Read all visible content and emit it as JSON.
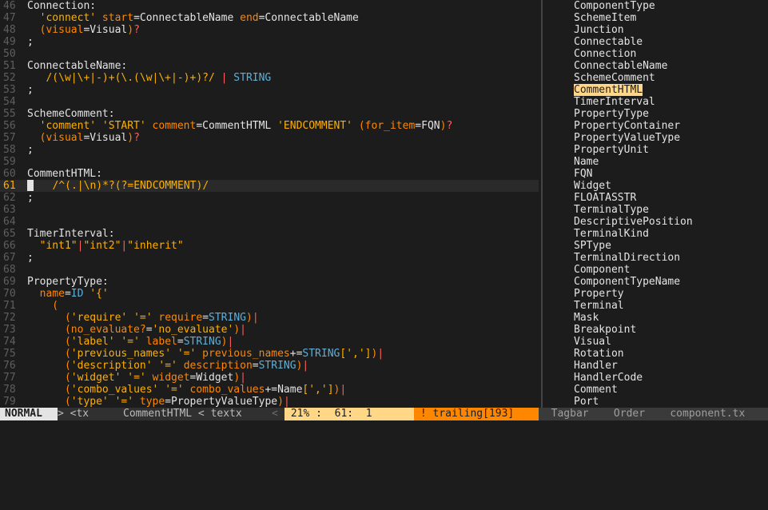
{
  "editor": {
    "lines": [
      {
        "n": "46",
        "segs": [
          [
            "w",
            "Connection:"
          ]
        ]
      },
      {
        "n": "47",
        "segs": [
          [
            "s",
            "  'connect'"
          ],
          [
            "w",
            " "
          ],
          [
            "k",
            "start"
          ],
          [
            "w",
            "=ConnectableName "
          ],
          [
            "k",
            "end"
          ],
          [
            "w",
            "=ConnectableName"
          ]
        ]
      },
      {
        "n": "48",
        "segs": [
          [
            "w",
            "  "
          ],
          [
            "k",
            "(visual"
          ],
          [
            "w",
            "=Visual"
          ],
          [
            "k",
            ")"
          ],
          [
            "op",
            "?"
          ]
        ]
      },
      {
        "n": "49",
        "segs": [
          [
            "w",
            ";"
          ]
        ]
      },
      {
        "n": "50",
        "segs": []
      },
      {
        "n": "51",
        "segs": [
          [
            "w",
            "ConnectableName:"
          ]
        ]
      },
      {
        "n": "52",
        "segs": [
          [
            "s",
            "   /(\\w|\\+|-)+(\\.(\\w|\\+|-)+)?/"
          ],
          [
            "w",
            " "
          ],
          [
            "op",
            "|"
          ],
          [
            "w",
            " "
          ],
          [
            "ty",
            "STRING"
          ]
        ]
      },
      {
        "n": "53",
        "segs": [
          [
            "w",
            ";"
          ]
        ]
      },
      {
        "n": "54",
        "segs": []
      },
      {
        "n": "55",
        "segs": [
          [
            "w",
            "SchemeComment:"
          ]
        ]
      },
      {
        "n": "56",
        "segs": [
          [
            "s",
            "  'comment' 'START'"
          ],
          [
            "w",
            " "
          ],
          [
            "k",
            "comment"
          ],
          [
            "w",
            "=CommentHTML "
          ],
          [
            "s",
            "'ENDCOMMENT'"
          ],
          [
            "w",
            " "
          ],
          [
            "k",
            "(for_item"
          ],
          [
            "w",
            "=FQN"
          ],
          [
            "k",
            ")"
          ],
          [
            "op",
            "?"
          ]
        ]
      },
      {
        "n": "57",
        "segs": [
          [
            "w",
            "  "
          ],
          [
            "k",
            "(visual"
          ],
          [
            "w",
            "=Visual"
          ],
          [
            "k",
            ")"
          ],
          [
            "op",
            "?"
          ]
        ]
      },
      {
        "n": "58",
        "segs": [
          [
            "w",
            ";"
          ]
        ]
      },
      {
        "n": "59",
        "segs": []
      },
      {
        "n": "60",
        "segs": [
          [
            "w",
            "CommentHTML:"
          ]
        ]
      },
      {
        "n": "61",
        "cur": true,
        "segs": [
          [
            "cursor",
            ""
          ],
          [
            "s",
            "   /^(.|\\n)*?(?=ENDCOMMENT)/"
          ]
        ]
      },
      {
        "n": "62",
        "segs": [
          [
            "w",
            ";"
          ]
        ]
      },
      {
        "n": "63",
        "segs": []
      },
      {
        "n": "64",
        "segs": []
      },
      {
        "n": "65",
        "segs": [
          [
            "w",
            "TimerInterval:"
          ]
        ]
      },
      {
        "n": "66",
        "segs": [
          [
            "s",
            "  \"int1\""
          ],
          [
            "op",
            "|"
          ],
          [
            "s",
            "\"int2\""
          ],
          [
            "op",
            "|"
          ],
          [
            "s",
            "\"inherit\""
          ]
        ]
      },
      {
        "n": "67",
        "segs": [
          [
            "w",
            ";"
          ]
        ]
      },
      {
        "n": "68",
        "segs": []
      },
      {
        "n": "69",
        "segs": [
          [
            "w",
            "PropertyType:"
          ]
        ]
      },
      {
        "n": "70",
        "segs": [
          [
            "w",
            "  "
          ],
          [
            "k",
            "name"
          ],
          [
            "w",
            "="
          ],
          [
            "ty",
            "ID"
          ],
          [
            "w",
            " "
          ],
          [
            "s",
            "'{'"
          ]
        ]
      },
      {
        "n": "71",
        "segs": [
          [
            "k",
            "    ("
          ]
        ]
      },
      {
        "n": "72",
        "segs": [
          [
            "w",
            "      "
          ],
          [
            "k",
            "("
          ],
          [
            "s",
            "'require'"
          ],
          [
            "w",
            " "
          ],
          [
            "s",
            "'='"
          ],
          [
            "w",
            " "
          ],
          [
            "k",
            "require"
          ],
          [
            "w",
            "="
          ],
          [
            "ty",
            "STRING"
          ],
          [
            "k",
            ")"
          ],
          [
            "op",
            "|"
          ]
        ]
      },
      {
        "n": "73",
        "segs": [
          [
            "w",
            "      "
          ],
          [
            "k",
            "(no_evaluate?"
          ],
          [
            "w",
            "="
          ],
          [
            "s",
            "'no_evaluate'"
          ],
          [
            "k",
            ")"
          ],
          [
            "op",
            "|"
          ]
        ]
      },
      {
        "n": "74",
        "segs": [
          [
            "w",
            "      "
          ],
          [
            "k",
            "("
          ],
          [
            "s",
            "'label'"
          ],
          [
            "w",
            " "
          ],
          [
            "s",
            "'='"
          ],
          [
            "w",
            " "
          ],
          [
            "k",
            "label"
          ],
          [
            "w",
            "="
          ],
          [
            "ty",
            "STRING"
          ],
          [
            "k",
            ")"
          ],
          [
            "op",
            "|"
          ]
        ]
      },
      {
        "n": "75",
        "segs": [
          [
            "w",
            "      "
          ],
          [
            "k",
            "("
          ],
          [
            "s",
            "'previous_names'"
          ],
          [
            "w",
            " "
          ],
          [
            "s",
            "'='"
          ],
          [
            "w",
            " "
          ],
          [
            "k",
            "previous_names"
          ],
          [
            "w",
            "+="
          ],
          [
            "ty",
            "STRING"
          ],
          [
            "s",
            "[',']"
          ],
          [
            "k",
            ")"
          ],
          [
            "op",
            "|"
          ]
        ]
      },
      {
        "n": "76",
        "segs": [
          [
            "w",
            "      "
          ],
          [
            "k",
            "("
          ],
          [
            "s",
            "'description'"
          ],
          [
            "w",
            " "
          ],
          [
            "s",
            "'='"
          ],
          [
            "w",
            " "
          ],
          [
            "k",
            "description"
          ],
          [
            "w",
            "="
          ],
          [
            "ty",
            "STRING"
          ],
          [
            "k",
            ")"
          ],
          [
            "op",
            "|"
          ]
        ]
      },
      {
        "n": "77",
        "segs": [
          [
            "w",
            "      "
          ],
          [
            "k",
            "("
          ],
          [
            "s",
            "'widget'"
          ],
          [
            "w",
            " "
          ],
          [
            "s",
            "'='"
          ],
          [
            "w",
            " "
          ],
          [
            "k",
            "widget"
          ],
          [
            "w",
            "=Widget"
          ],
          [
            "k",
            ")"
          ],
          [
            "op",
            "|"
          ]
        ]
      },
      {
        "n": "78",
        "segs": [
          [
            "w",
            "      "
          ],
          [
            "k",
            "("
          ],
          [
            "s",
            "'combo_values'"
          ],
          [
            "w",
            " "
          ],
          [
            "s",
            "'='"
          ],
          [
            "w",
            " "
          ],
          [
            "k",
            "combo_values"
          ],
          [
            "w",
            "+=Name"
          ],
          [
            "s",
            "[',']"
          ],
          [
            "k",
            ")"
          ],
          [
            "op",
            "|"
          ]
        ]
      },
      {
        "n": "79",
        "segs": [
          [
            "w",
            "      "
          ],
          [
            "k",
            "("
          ],
          [
            "s",
            "'type'"
          ],
          [
            "w",
            " "
          ],
          [
            "s",
            "'='"
          ],
          [
            "w",
            " "
          ],
          [
            "k",
            "type"
          ],
          [
            "w",
            "=PropertyValueType"
          ],
          [
            "k",
            ")"
          ],
          [
            "op",
            "|"
          ]
        ]
      }
    ]
  },
  "tagbar": {
    "items": [
      "ComponentType",
      "SchemeItem",
      "Junction",
      "Connectable",
      "Connection",
      "ConnectableName",
      "SchemeComment",
      "CommentHTML",
      "TimerInterval",
      "PropertyType",
      "PropertyContainer",
      "PropertyValueType",
      "PropertyUnit",
      "Name",
      "FQN",
      "Widget",
      "FLOATASSTR",
      "TerminalType",
      "DescriptivePosition",
      "TerminalKind",
      "SPType",
      "TerminalDirection",
      "Component",
      "ComponentTypeName",
      "Property",
      "Terminal",
      "Mask",
      "Breakpoint",
      "Visual",
      "Rotation",
      "Handler",
      "HandlerCode",
      "Comment",
      "Port"
    ],
    "highlighted_index": 7
  },
  "statusline": {
    "mode": "NORMAL",
    "filetype": "> <tx",
    "location": "CommentHTML < textx",
    "separator": "<",
    "position": " 21% :  61:  1",
    "warning": " ! trailing[193]",
    "tagbar_label": "  Tagbar    Order    component.tx"
  },
  "colors": {
    "background": "#1c1c1c",
    "string": "#ffaf00",
    "keyword": "#ff8700",
    "type": "#5fafd7",
    "operator": "#ff5f5f",
    "highlight": "#ffd787"
  }
}
